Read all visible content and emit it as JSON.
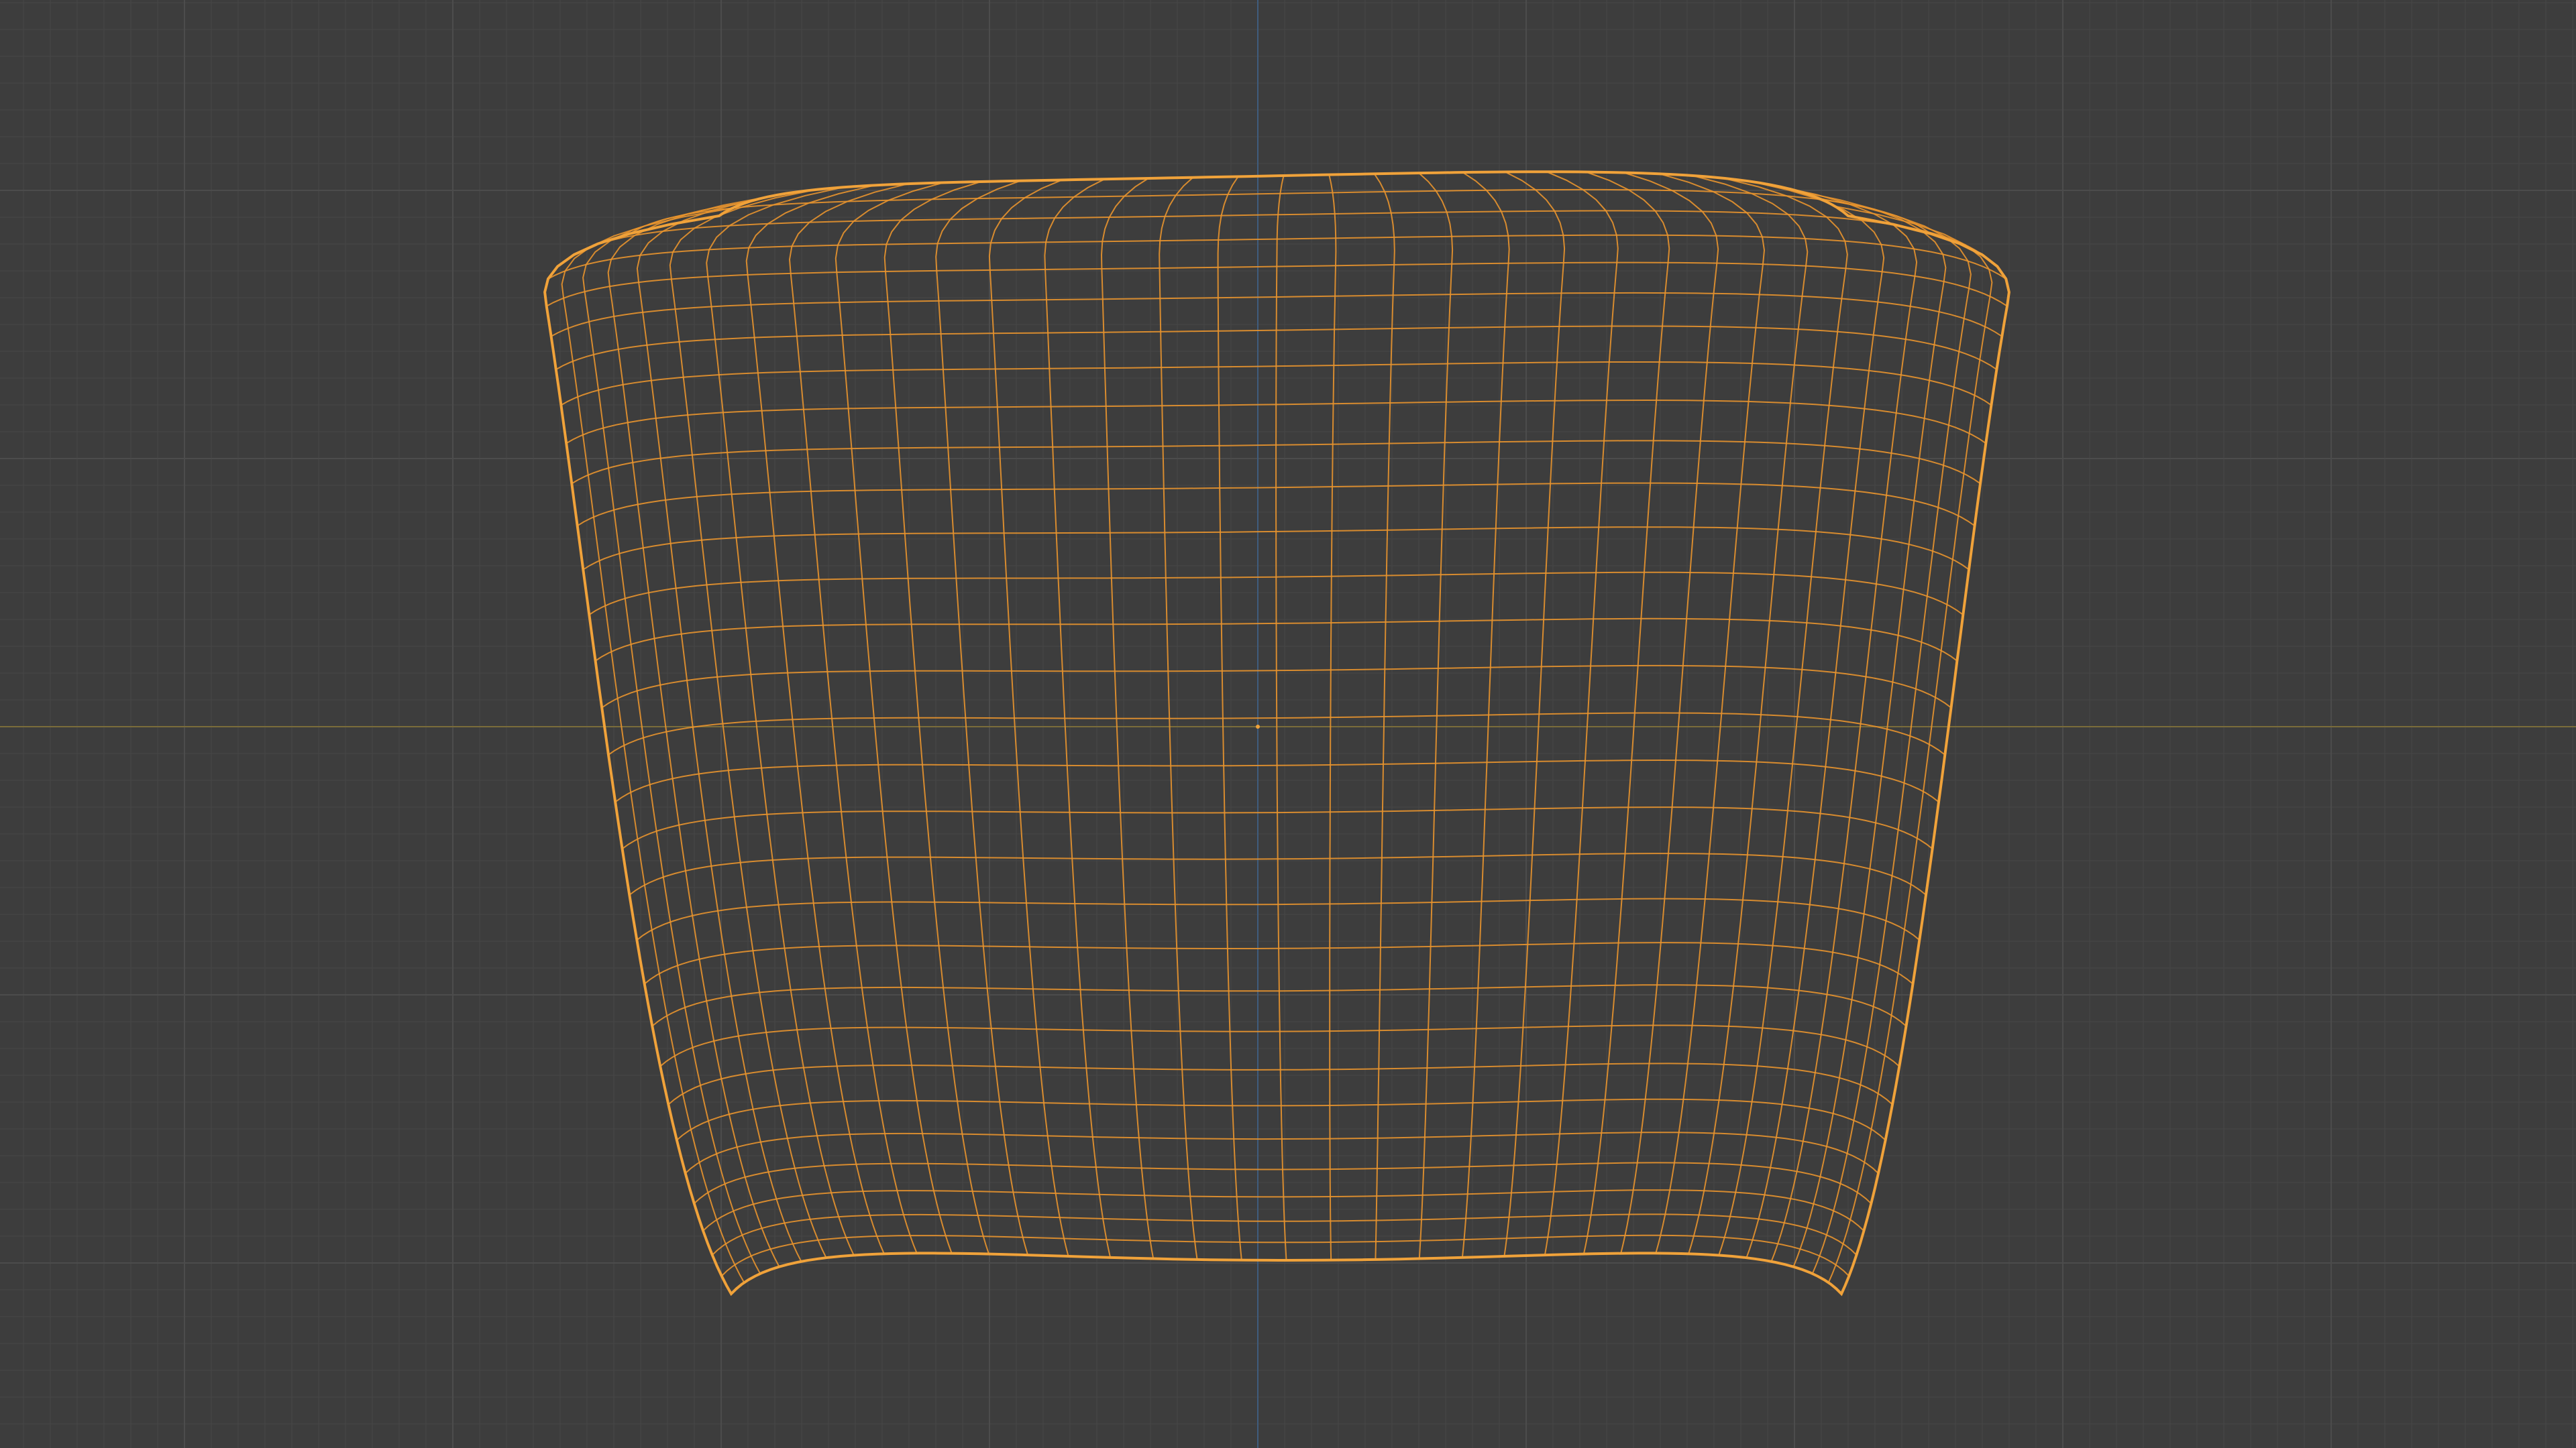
{
  "viewport": {
    "view_mode": "wireframe",
    "object_selected": true,
    "background_color": "#3d3d3d",
    "grid_minor_color": "#454545",
    "grid_major_color": "#4c4c4c",
    "x_axis_color": "#7a6c3a",
    "z_axis_color": "#3f5c7d",
    "mesh_color": "#e8942d",
    "mesh_outline_color": "#f0a23a",
    "origin_color": "#f0a23a"
  }
}
